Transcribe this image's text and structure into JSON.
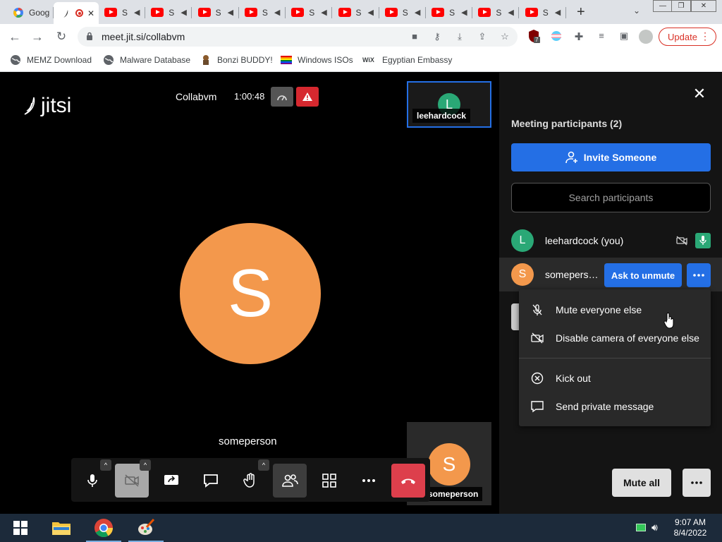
{
  "browser": {
    "tabs": [
      {
        "title": "Goog",
        "icon": "google-icon"
      },
      {
        "title": "",
        "icon": "jitsi-icon",
        "active": true
      },
      {
        "title": "S",
        "icon": "youtube-icon"
      },
      {
        "title": "S",
        "icon": "youtube-icon"
      },
      {
        "title": "S",
        "icon": "youtube-icon"
      },
      {
        "title": "S",
        "icon": "youtube-icon"
      },
      {
        "title": "S",
        "icon": "youtube-icon"
      },
      {
        "title": "S",
        "icon": "youtube-icon"
      },
      {
        "title": "S",
        "icon": "youtube-icon"
      },
      {
        "title": "S",
        "icon": "youtube-icon"
      },
      {
        "title": "S",
        "icon": "youtube-icon"
      },
      {
        "title": "S",
        "icon": "youtube-icon"
      }
    ],
    "url": "meet.jit.si/collabvm",
    "update_label": "Update",
    "extension_badge": "7",
    "bookmarks": [
      {
        "label": "MEMZ Download",
        "icon": "globe-icon"
      },
      {
        "label": "Malware Database",
        "icon": "globe-icon"
      },
      {
        "label": "Bonzi BUDDY!",
        "icon": "bonzi-icon"
      },
      {
        "label": "Windows ISOs",
        "icon": "rainbow-flag-icon"
      },
      {
        "label": "Egyptian Embassy",
        "icon": "wix-icon"
      }
    ],
    "wix_text": "WiX"
  },
  "meeting": {
    "logo_text": "jitsi",
    "title": "Collabvm",
    "timer": "1:00:48",
    "stage_avatar_letter": "S",
    "stage_name": "someperson",
    "thumb_top": {
      "letter": "L",
      "name": "leehardcock"
    },
    "thumb_bottom": {
      "letter": "S",
      "name": "someperson"
    }
  },
  "pane": {
    "title": "Meeting participants (2)",
    "invite_label": "Invite Someone",
    "search_placeholder": "Search participants",
    "participants": [
      {
        "letter": "L",
        "name": "leehardcock (you)",
        "color": "#2aa876"
      },
      {
        "letter": "S",
        "name": "somepers…",
        "color": "#f3984c"
      }
    ],
    "ask_unmute_label": "Ask to unmute",
    "menu": [
      {
        "label": "Mute everyone else",
        "icon": "mic-off-icon"
      },
      {
        "label": "Disable camera of everyone else",
        "icon": "camera-off-icon"
      },
      {
        "label": "Kick out",
        "icon": "close-circle-icon"
      },
      {
        "label": "Send private message",
        "icon": "message-icon"
      }
    ],
    "mute_all_label": "Mute all"
  },
  "taskbar": {
    "time": "9:07 AM",
    "date": "8/4/2022"
  },
  "colors": {
    "accent": "#246fe5",
    "hangup": "#dd3f4c",
    "avatar_orange": "#f3984c",
    "avatar_green": "#2aa876"
  }
}
